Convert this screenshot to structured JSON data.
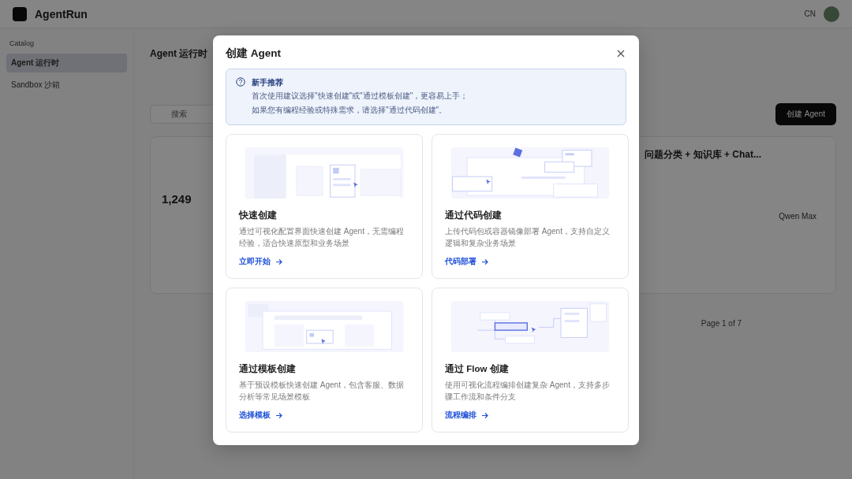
{
  "background": {
    "app_name": "AgentRun",
    "sidebar_heading": "Catalog",
    "sidebar_items": [
      {
        "label": "Agent 运行时",
        "selected": true
      },
      {
        "label": "Sandbox 沙箱",
        "selected": false
      }
    ],
    "language": "CN",
    "page_title": "Agent 运行时",
    "search_placeholder": "搜索",
    "create_button": "创建 Agent",
    "card_stat": "1,249",
    "card_title": "问题分类 + 知识库 + Chat...",
    "model": "Qwen Max",
    "pagination": "Page 1 of 7"
  },
  "dialog": {
    "title": "创建 Agent",
    "tip": {
      "title": "新手推荐",
      "lines": [
        "首次使用建议选择\"快速创建\"或\"通过模板创建\"，更容易上手；",
        "如果您有编程经验或特殊需求，请选择\"通过代码创建\"。"
      ]
    },
    "options": [
      {
        "kind": "form",
        "title": "快速创建",
        "description": "通过可视化配置界面快速创建 Agent，无需编程经验，适合快速原型和业务场景",
        "link": "立即开始"
      },
      {
        "kind": "code",
        "title": "通过代码创建",
        "description": "上传代码包或容器镜像部署 Agent，支持自定义逻辑和复杂业务场景",
        "link": "代码部署"
      },
      {
        "kind": "template",
        "title": "通过模板创建",
        "description": "基于预设模板快速创建 Agent，包含客服、数据分析等常见场景模板",
        "link": "选择模板"
      },
      {
        "kind": "flow",
        "title": "通过 Flow 创建",
        "description": "使用可视化流程编排创建复杂 Agent，支持多步骤工作流和条件分支",
        "link": "流程编排"
      }
    ]
  }
}
